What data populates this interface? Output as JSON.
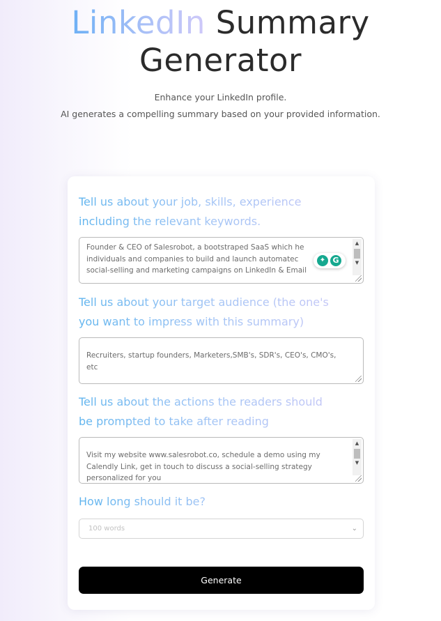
{
  "header": {
    "title_highlight": "LinkedIn",
    "title_rest": "Summary",
    "title_line2": "Generator",
    "subtitle_line1": "Enhance your LinkedIn profile.",
    "subtitle_line2": "AI generates a compelling summary based on your provided information."
  },
  "form": {
    "q1": {
      "label_line1": "Tell us about your job, skills, experience",
      "label_line2": "including the relevant keywords.",
      "value_lines": [
        "Founder & CEO of Salesrobot, a bootstraped SaaS which he",
        "individuals and companies to build and launch automatec",
        "social-selling and marketing campaigns on LinkedIn & Email"
      ]
    },
    "q2": {
      "label_line1": "Tell us about your target audience (the one's",
      "label_line2": "you want to impress with this summary)",
      "value": "Recruiters, startup founders, Marketers,SMB's, SDR's, CEO's, CMO's, etc"
    },
    "q3": {
      "label_line1": "Tell us about the actions the readers should",
      "label_line2": "be prompted to take after reading",
      "value_lines": [
        "Visit my website www.salesrobot.co, schedule a demo using my",
        "Calendly Link, get in touch to discuss a social-selling strategy",
        "personalized for you"
      ]
    },
    "q4": {
      "label": "How long should it be?",
      "selected": "100 words"
    },
    "generate_label": "Generate"
  },
  "icons": {
    "grammarly_bulb": "lightbulb-icon",
    "grammarly_logo": "grammarly-icon",
    "accent_color": "#15a88f"
  }
}
